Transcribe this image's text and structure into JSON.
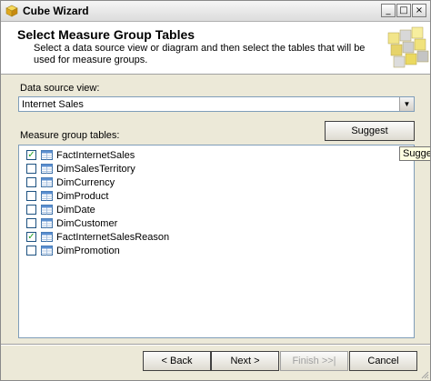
{
  "window": {
    "title": "Cube Wizard",
    "controls": {
      "minimize": "_",
      "maximize": "□",
      "close": "×"
    }
  },
  "header": {
    "title": "Select Measure Group Tables",
    "description": "Select a data source view or diagram and then select the tables that will be used for measure groups."
  },
  "data_source_view": {
    "label": "Data source view:",
    "selected": "Internet Sales"
  },
  "measure_group_tables": {
    "label": "Measure group tables:",
    "suggest_label": "Suggest",
    "tooltip": "Sugges",
    "items": [
      {
        "name": "FactInternetSales",
        "checked": true
      },
      {
        "name": "DimSalesTerritory",
        "checked": false
      },
      {
        "name": "DimCurrency",
        "checked": false
      },
      {
        "name": "DimProduct",
        "checked": false
      },
      {
        "name": "DimDate",
        "checked": false
      },
      {
        "name": "DimCustomer",
        "checked": false
      },
      {
        "name": "FactInternetSalesReason",
        "checked": true
      },
      {
        "name": "DimPromotion",
        "checked": false
      }
    ]
  },
  "footer": {
    "back_label": "< Back",
    "next_label": "Next >",
    "finish_label": "Finish >>|",
    "cancel_label": "Cancel"
  },
  "colors": {
    "dialog_background": "#ece9d8",
    "check_mark": "#21a121",
    "field_border": "#7f9db9",
    "tooltip_background": "#ffffe1"
  },
  "icons": {
    "app": "cube-wizard-icon",
    "table": "table-icon",
    "header_graphic": "cube-graphic-icon"
  }
}
